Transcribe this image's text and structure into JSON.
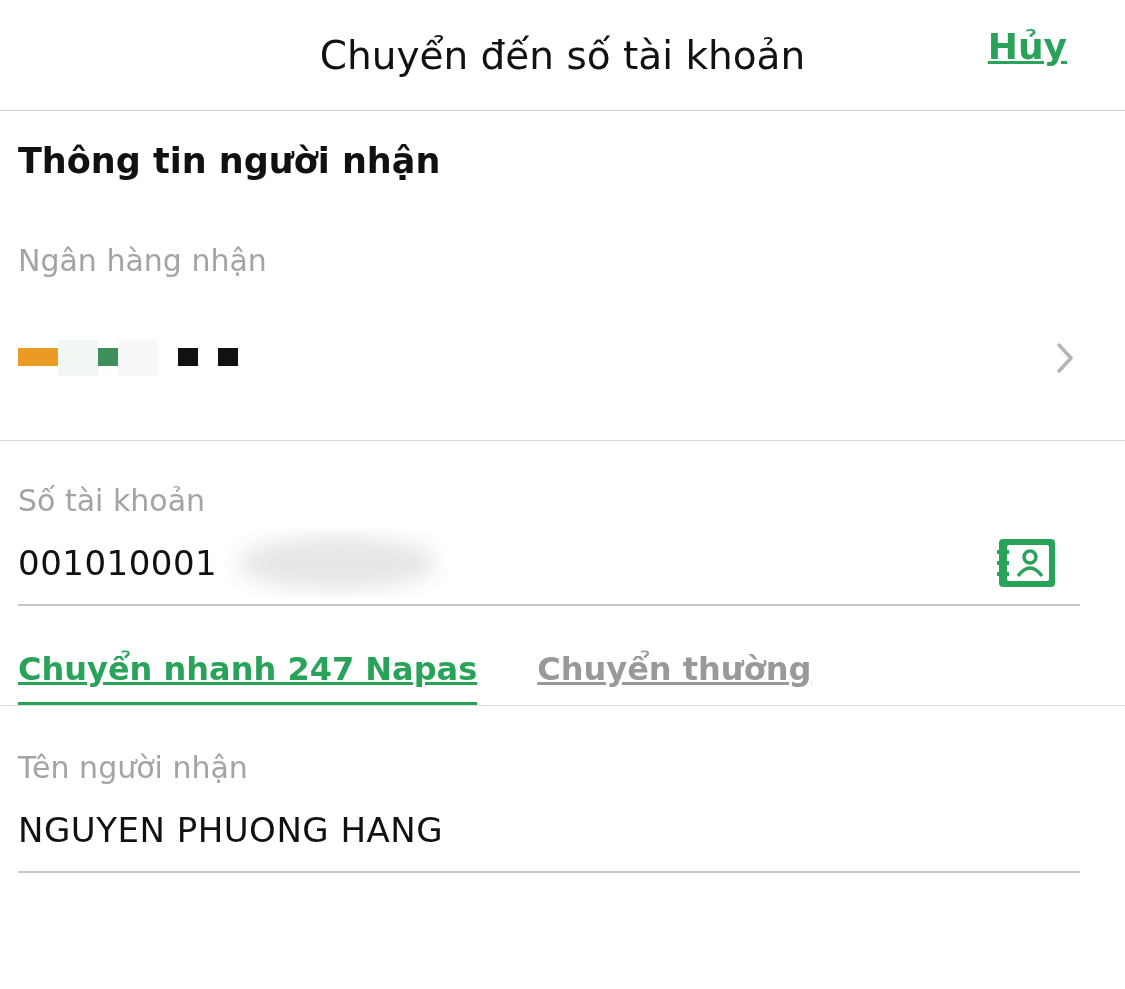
{
  "header": {
    "title": "Chuyển đến số tài khoản",
    "cancel": "Hủy"
  },
  "section_title": "Thông tin người nhận",
  "bank": {
    "label": "Ngân hàng nhận"
  },
  "account": {
    "label": "Số tài khoản",
    "value": "001010001"
  },
  "tabs": [
    {
      "label": "Chuyển nhanh 247 Napas",
      "selected": true
    },
    {
      "label": "Chuyển thường",
      "selected": false
    }
  ],
  "recipient": {
    "label": "Tên người nhận",
    "value": "NGUYEN PHUONG HANG"
  }
}
